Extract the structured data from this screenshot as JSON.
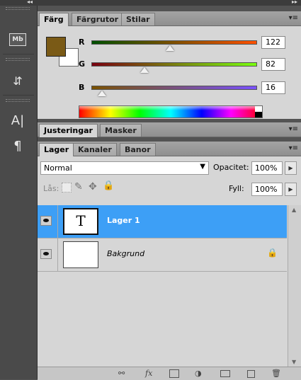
{
  "top": {
    "collapse_left": "◂◂",
    "collapse_right": "▸▸"
  },
  "dock": {
    "icons": [
      {
        "name": "mini-bridge-icon",
        "text": "Mb"
      },
      {
        "name": "history-icon",
        "text": "⇵"
      },
      {
        "name": "character-icon",
        "text": "A|"
      },
      {
        "name": "paragraph-icon",
        "text": "¶"
      }
    ]
  },
  "color_panel": {
    "tabs": [
      "Färg",
      "Färgrutor",
      "Stilar"
    ],
    "foreground_color": "#7a5a16",
    "background_color": "#ffffff",
    "sliders": [
      {
        "label": "R",
        "value": "122",
        "fraction": 0.478
      },
      {
        "label": "G",
        "value": "82",
        "fraction": 0.322
      },
      {
        "label": "B",
        "value": "16",
        "fraction": 0.063
      }
    ]
  },
  "adjustments_panel": {
    "tabs": [
      "Justeringar",
      "Masker"
    ]
  },
  "layers_panel": {
    "tabs": [
      "Lager",
      "Kanaler",
      "Banor"
    ],
    "blend_mode": "Normal",
    "opacity_label": "Opacitet:",
    "opacity_value": "100%",
    "lock_label": "Lås:",
    "fill_label": "Fyll:",
    "fill_value": "100%",
    "layers": [
      {
        "name": "Lager 1",
        "thumb_glyph": "T",
        "selected": true
      },
      {
        "name": "Bakgrund",
        "thumb_glyph": "",
        "selected": false
      }
    ],
    "bottom_icons": [
      "link-icon",
      "fx-icon",
      "mask-icon",
      "adjustment-icon",
      "group-icon",
      "new-layer-icon",
      "trash-icon"
    ],
    "fx_label": "fx"
  },
  "colors": {
    "selection": "#3d9ff6",
    "panel": "#d6d6d6"
  }
}
